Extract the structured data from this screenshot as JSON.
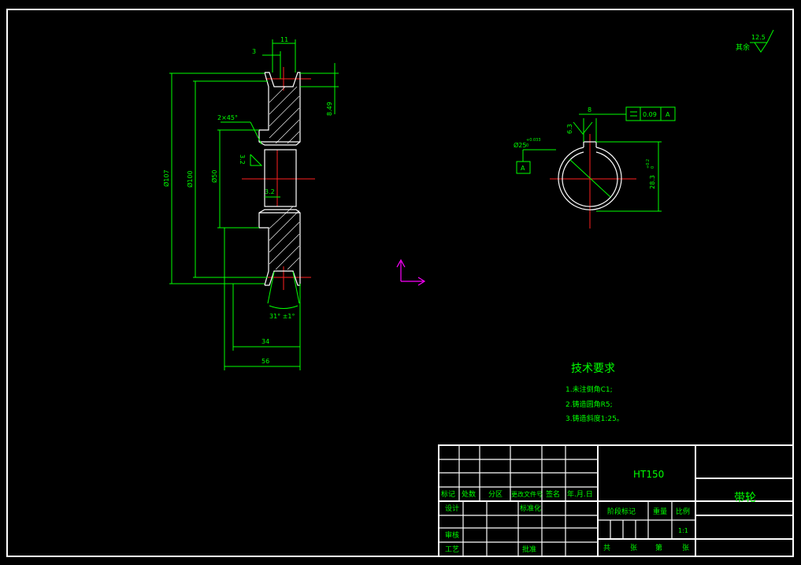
{
  "dims": {
    "d107": "Ø107",
    "d100": "Ø100",
    "d50": "Ø50",
    "w11": "11",
    "w3": "3",
    "h8_49": "8.49",
    "chamfer": "2×45°",
    "r32a": "3.2",
    "r32b": "3.2",
    "angle": "31° ±1°",
    "w34": "34",
    "w56": "56"
  },
  "section_b": {
    "w8": "8",
    "r63": "6.3",
    "tol_val": "0.09",
    "tol_ref": "A",
    "bore": "Ø25",
    "bore_tol": "+0.033",
    "bore_tol2": "0",
    "datum": "A",
    "key": "28.3",
    "key_tol": "+0.2",
    "key_tol2": "0"
  },
  "roughness": {
    "label": "其余",
    "value": "12.5"
  },
  "tech": {
    "title": "技术要求",
    "items": [
      "1.未注倒角C1;",
      "2.铸造圆角R5;",
      "3.铸造斜度1:25。"
    ]
  },
  "titleblock": {
    "material": "HT150",
    "part_name": "带轮",
    "row_mark": "标记",
    "row_count": "处数",
    "row_zone": "分区",
    "row_docno": "更改文件号",
    "row_sign": "签名",
    "row_date": "年.月.日",
    "design": "设计",
    "standard": "标准化",
    "check": "审核",
    "process": "工艺",
    "approve": "批准",
    "stage": "阶段标记",
    "weight": "重量",
    "scale": "比例",
    "scale_val": "1:1",
    "total": "共",
    "sheets": "张",
    "page": "第",
    "sheets2": "张"
  }
}
